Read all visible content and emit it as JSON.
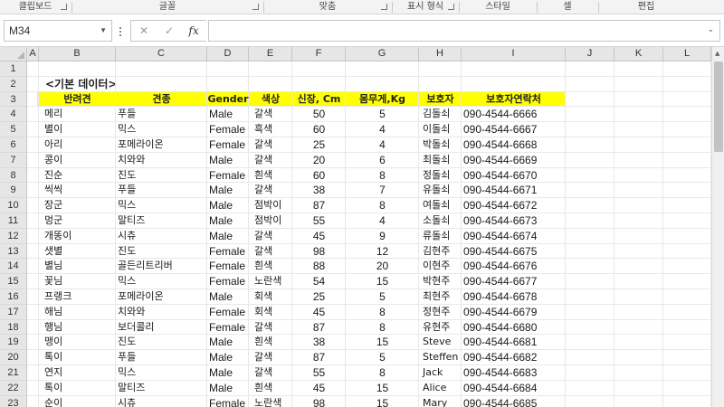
{
  "ribbon": {
    "groups": [
      {
        "label": "클립보드"
      },
      {
        "label": "글꼴"
      },
      {
        "label": "맞춤"
      },
      {
        "label": "표시 형식"
      },
      {
        "label": "스타일"
      },
      {
        "label": "셀"
      },
      {
        "label": "편집"
      }
    ]
  },
  "formula_bar": {
    "name_box": "M34",
    "cancel_icon": "✕",
    "enter_icon": "✓",
    "fx_label": "fx",
    "formula": ""
  },
  "sheet": {
    "columns": [
      "A",
      "B",
      "C",
      "D",
      "E",
      "F",
      "G",
      "H",
      "I",
      "J",
      "K",
      "L"
    ],
    "rows": [
      "1",
      "2",
      "3",
      "4",
      "5",
      "6",
      "7",
      "8",
      "9",
      "10",
      "11",
      "12",
      "13",
      "14",
      "15",
      "16",
      "17",
      "18",
      "19",
      "20",
      "21",
      "22",
      "23"
    ],
    "title": "<기본 데이터>",
    "headers": [
      "반려견",
      "견종",
      "Gender",
      "색상",
      "신장, Cm",
      "몸무게,Kg",
      "보호자",
      "보호자연락처"
    ],
    "data": [
      [
        "메리",
        "푸들",
        "Male",
        "갈색",
        "50",
        "5",
        "김돌쇠",
        "090-4544-6666"
      ],
      [
        "별이",
        "믹스",
        "Female",
        "흑색",
        "60",
        "4",
        "이돌쇠",
        "090-4544-6667"
      ],
      [
        "아리",
        "포메라이온",
        "Female",
        "갈색",
        "25",
        "4",
        "박돌쇠",
        "090-4544-6668"
      ],
      [
        "콩이",
        "치와와",
        "Male",
        "갈색",
        "20",
        "6",
        "최돌쇠",
        "090-4544-6669"
      ],
      [
        "진순",
        "진도",
        "Female",
        "흰색",
        "60",
        "8",
        "정돌쇠",
        "090-4544-6670"
      ],
      [
        "씩씩",
        "푸들",
        "Male",
        "갈색",
        "38",
        "7",
        "유돌쇠",
        "090-4544-6671"
      ],
      [
        "장군",
        "믹스",
        "Male",
        "점박이",
        "87",
        "8",
        "여돌쇠",
        "090-4544-6672"
      ],
      [
        "멍군",
        "말티즈",
        "Male",
        "점박이",
        "55",
        "4",
        "소돌쇠",
        "090-4544-6673"
      ],
      [
        "개똥이",
        "시츄",
        "Male",
        "갈색",
        "45",
        "9",
        "류돌쇠",
        "090-4544-6674"
      ],
      [
        "샛별",
        "진도",
        "Female",
        "갈색",
        "98",
        "12",
        "김현주",
        "090-4544-6675"
      ],
      [
        "별님",
        "골든리트리버",
        "Female",
        "흰색",
        "88",
        "20",
        "이현주",
        "090-4544-6676"
      ],
      [
        "꽃님",
        "믹스",
        "Female",
        "노란색",
        "54",
        "15",
        "박현주",
        "090-4544-6677"
      ],
      [
        "프랭크",
        "포메라이온",
        "Male",
        "회색",
        "25",
        "5",
        "최현주",
        "090-4544-6678"
      ],
      [
        "해님",
        "치와와",
        "Female",
        "회색",
        "45",
        "8",
        "정현주",
        "090-4544-6679"
      ],
      [
        "행님",
        "보더콜리",
        "Female",
        "갈색",
        "87",
        "8",
        "유현주",
        "090-4544-6680"
      ],
      [
        "맹이",
        "진도",
        "Male",
        "흰색",
        "38",
        "15",
        "Steve",
        "090-4544-6681"
      ],
      [
        "톡이",
        "푸들",
        "Male",
        "갈색",
        "87",
        "5",
        "Steffen",
        "090-4544-6682"
      ],
      [
        "연지",
        "믹스",
        "Male",
        "갈색",
        "55",
        "8",
        "Jack",
        "090-4544-6683"
      ],
      [
        "톡이",
        "말티즈",
        "Male",
        "흰색",
        "45",
        "15",
        "Alice",
        "090-4544-6684"
      ],
      [
        "순이",
        "시츄",
        "Female",
        "노란색",
        "98",
        "15",
        "Mary",
        "090-4544-6685"
      ]
    ]
  },
  "colors": {
    "header_highlight": "#ffff00",
    "grid_line": "#e8e8e8",
    "header_bg": "#e6e6e6"
  }
}
